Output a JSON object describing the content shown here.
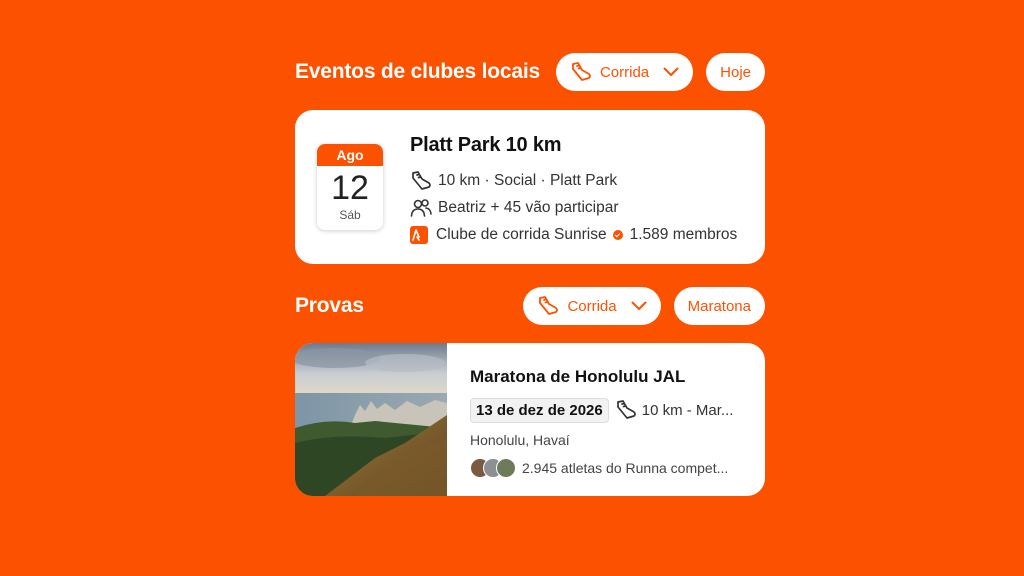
{
  "colors": {
    "accent": "#fc5200",
    "card": "#ffffff"
  },
  "local_events": {
    "title": "Eventos de clubes locais",
    "sport_filter": {
      "label": "Corrida",
      "icon": "running-shoe-icon"
    },
    "date_filter": {
      "label": "Hoje"
    },
    "event": {
      "month": "Ago",
      "day": "12",
      "weekday": "Sáb",
      "title": "Platt Park 10 km",
      "details": "10 km · Social · Platt Park",
      "attendees": "Beatriz + 45 vão participar",
      "club_name": "Clube de corrida Sunrise",
      "club_members": "1.589 membros"
    }
  },
  "races": {
    "title": "Provas",
    "sport_filter": {
      "label": "Corrida",
      "icon": "running-shoe-icon"
    },
    "type_filter": {
      "label": "Maratona"
    },
    "race": {
      "title": "Maratona de Honolulu JAL",
      "date": "13 de dez de 2026",
      "distance": "10 km - Mar...",
      "location": "Honolulu, Havaí",
      "athletes": "2.945 atletas do Runna compet..."
    }
  }
}
